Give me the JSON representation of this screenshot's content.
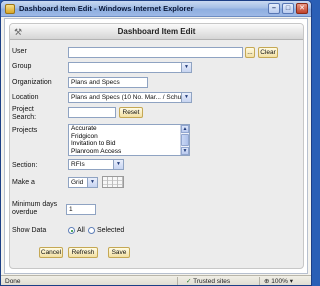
{
  "window": {
    "title": "Dashboard Item Edit - Windows Internet Explorer",
    "minimize_glyph": "–",
    "maximize_glyph": "□",
    "close_glyph": "✕"
  },
  "panel": {
    "title": "Dashboard Item Edit",
    "icon": "tools-icon"
  },
  "form": {
    "user": {
      "label": "User",
      "value": "",
      "browse_label": "...",
      "clear_label": "Clear"
    },
    "group": {
      "label": "Group",
      "value": ""
    },
    "organization": {
      "label": "Organization",
      "value": "Plans and Specs"
    },
    "location": {
      "label": "Location",
      "value": "Plans and Specs (10 No. Mar... / Schu"
    },
    "project_search": {
      "label_line1": "Project",
      "label_line2": "Search:",
      "value": "",
      "reset_label": "Reset"
    },
    "projects": {
      "label": "Projects",
      "items": [
        "Accurate",
        "Fridgicon",
        "Invitation to Bid",
        "Planroom Access"
      ]
    },
    "section": {
      "label": "Section:",
      "value": "RFIs"
    },
    "make_a": {
      "label": "Make a",
      "value": "Grid"
    },
    "min_days": {
      "label_line1": "Minimum days",
      "label_line2": "overdue",
      "value": "1"
    },
    "show_data": {
      "label": "Show Data",
      "option_all": "All",
      "option_selected": "Selected",
      "selected": "All"
    }
  },
  "actions": {
    "cancel_label": "Cancel",
    "refresh_label": "Refresh",
    "save_label": "Save"
  },
  "statusbar": {
    "status": "Done",
    "zone": "Trusted sites",
    "zoom": "100%"
  },
  "colors": {
    "button_fill": "#f2dfa3",
    "title_bar": "#a5bfe6"
  }
}
